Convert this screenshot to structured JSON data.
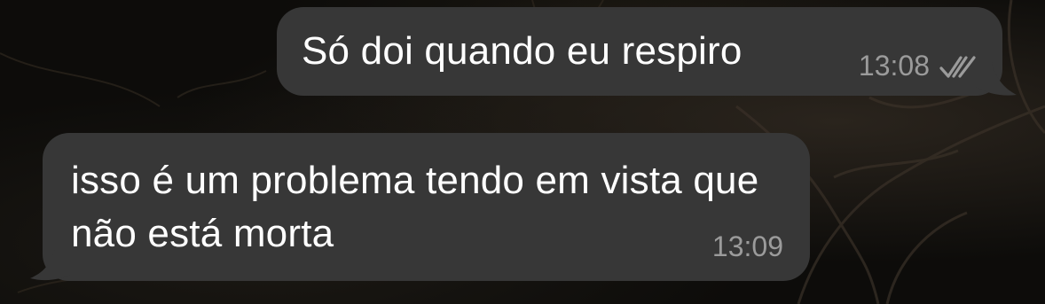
{
  "messages": [
    {
      "direction": "outgoing",
      "text": "Só doi quando eu respiro",
      "time": "13:08",
      "status_icon": "double-check-icon"
    },
    {
      "direction": "incoming",
      "text": "isso é um problema tendo em vista que não está morta",
      "time": "13:09"
    }
  ],
  "colors": {
    "bubble": "#373737",
    "text": "#ffffff",
    "meta": "#9b9b9b",
    "background": "#0d0c0a"
  }
}
